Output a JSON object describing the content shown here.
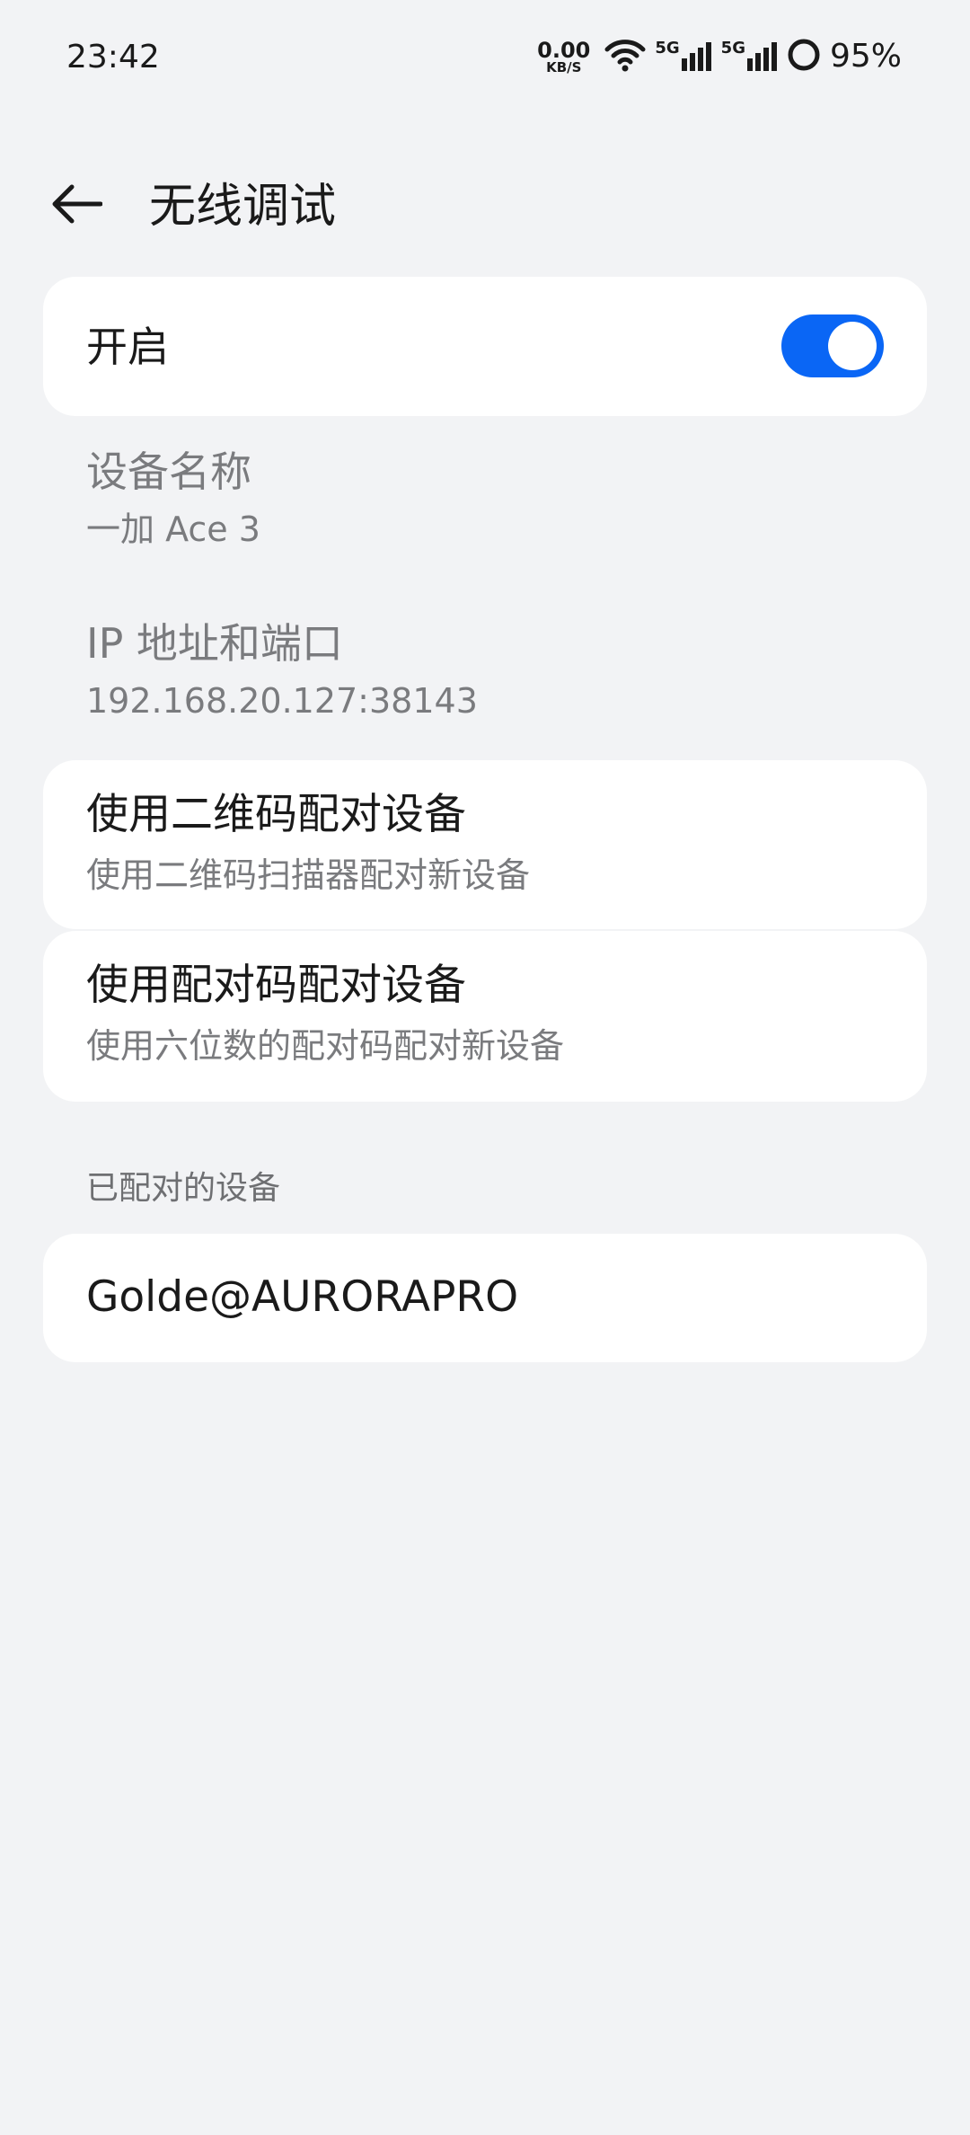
{
  "status_bar": {
    "time": "23:42",
    "net_speed_value": "0.00",
    "net_speed_unit": "KB/S",
    "signal_1_label": "5G",
    "signal_2_label": "5G",
    "battery_percent": "95%"
  },
  "header": {
    "title": "无线调试"
  },
  "toggle": {
    "label": "开启",
    "enabled": true,
    "accent_color": "#0a66f5"
  },
  "device_name": {
    "title": "设备名称",
    "value": "一加 Ace 3"
  },
  "ip_port": {
    "title": "IP 地址和端口",
    "value": "192.168.20.127:38143"
  },
  "pair_qr": {
    "title": "使用二维码配对设备",
    "subtitle": "使用二维码扫描器配对新设备"
  },
  "pair_code": {
    "title": "使用配对码配对设备",
    "subtitle": "使用六位数的配对码配对新设备"
  },
  "paired_devices": {
    "section_label": "已配对的设备",
    "items": [
      {
        "name": "Golde@AURORAPRO"
      }
    ]
  }
}
